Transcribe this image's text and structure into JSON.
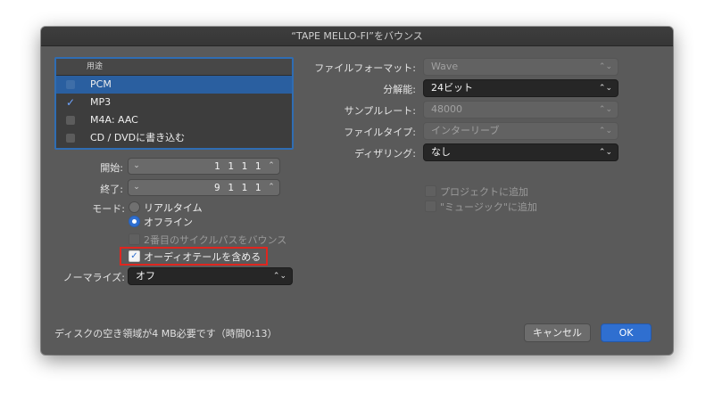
{
  "window": {
    "title": "“TAPE MELLO-FI”をバウンス"
  },
  "destinations": {
    "header": "用途",
    "items": [
      {
        "label": "PCM",
        "checked": false,
        "selected": true
      },
      {
        "label": "MP3",
        "checked": true,
        "selected": false
      },
      {
        "label": "M4A: AAC",
        "checked": false,
        "selected": false
      },
      {
        "label": "CD / DVDに書き込む",
        "checked": false,
        "selected": false
      }
    ]
  },
  "range": {
    "start_label": "開始:",
    "start_value": "1 1 1    1",
    "end_label": "終了:",
    "end_value": "9 1 1    1"
  },
  "mode": {
    "label": "モード:",
    "realtime": "リアルタイム",
    "offline": "オフライン",
    "selected": "offline"
  },
  "options": {
    "second_cycle": "2番目のサイクルパスをバウンス",
    "include_tail": "オーディオテールを含める"
  },
  "normalize": {
    "label": "ノーマライズ:",
    "value": "オフ"
  },
  "format": {
    "file_format_label": "ファイルフォーマット:",
    "file_format_value": "Wave",
    "resolution_label": "分解能:",
    "resolution_value": "24ビット",
    "sample_rate_label": "サンプルレート:",
    "sample_rate_value": "48000",
    "file_type_label": "ファイルタイプ:",
    "file_type_value": "インターリーブ",
    "dither_label": "ディザリング:",
    "dither_value": "なし"
  },
  "add": {
    "project": "プロジェクトに追加",
    "music": "\"ミュージック\"に追加"
  },
  "footer": {
    "disk_info": "ディスクの空き領域が4 MB必要です（時間0:13）",
    "cancel": "キャンセル",
    "ok": "OK"
  },
  "colors": {
    "accent": "#2f6fd0",
    "highlight_box": "#e0261f",
    "window_bg": "#5a5a5a"
  }
}
